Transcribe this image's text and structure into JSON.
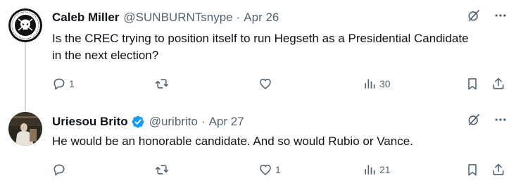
{
  "tweets": [
    {
      "name": "Caleb Miller",
      "handle": "@SUNBURNTsnype",
      "separator": "·",
      "time": "Apr 26",
      "text": "Is the CREC trying to position itself to run Hegseth as a Presidential Candidate in the next election?",
      "verified": false,
      "actions": {
        "replies": "1",
        "reposts": "",
        "likes": "",
        "views": "30"
      },
      "avatar_text": "DADDY LAZY ROCK HARD"
    },
    {
      "name": "Uriesou Brito",
      "handle": "@uribrito",
      "separator": "·",
      "time": "Apr 27",
      "text": "He would be an honorable candidate. And so would Rubio or Vance.",
      "verified": true,
      "actions": {
        "replies": "",
        "reposts": "",
        "likes": "1",
        "views": "21"
      }
    }
  ],
  "colors": {
    "text": "#0f1419",
    "secondary": "#536471",
    "verified": "#1d9bf0",
    "thread_line": "#cfd9de"
  },
  "icons": [
    "reply-icon",
    "repost-icon",
    "like-icon",
    "views-icon",
    "bookmark-icon",
    "share-icon",
    "grok-icon",
    "more-icon",
    "verified-badge-icon"
  ]
}
